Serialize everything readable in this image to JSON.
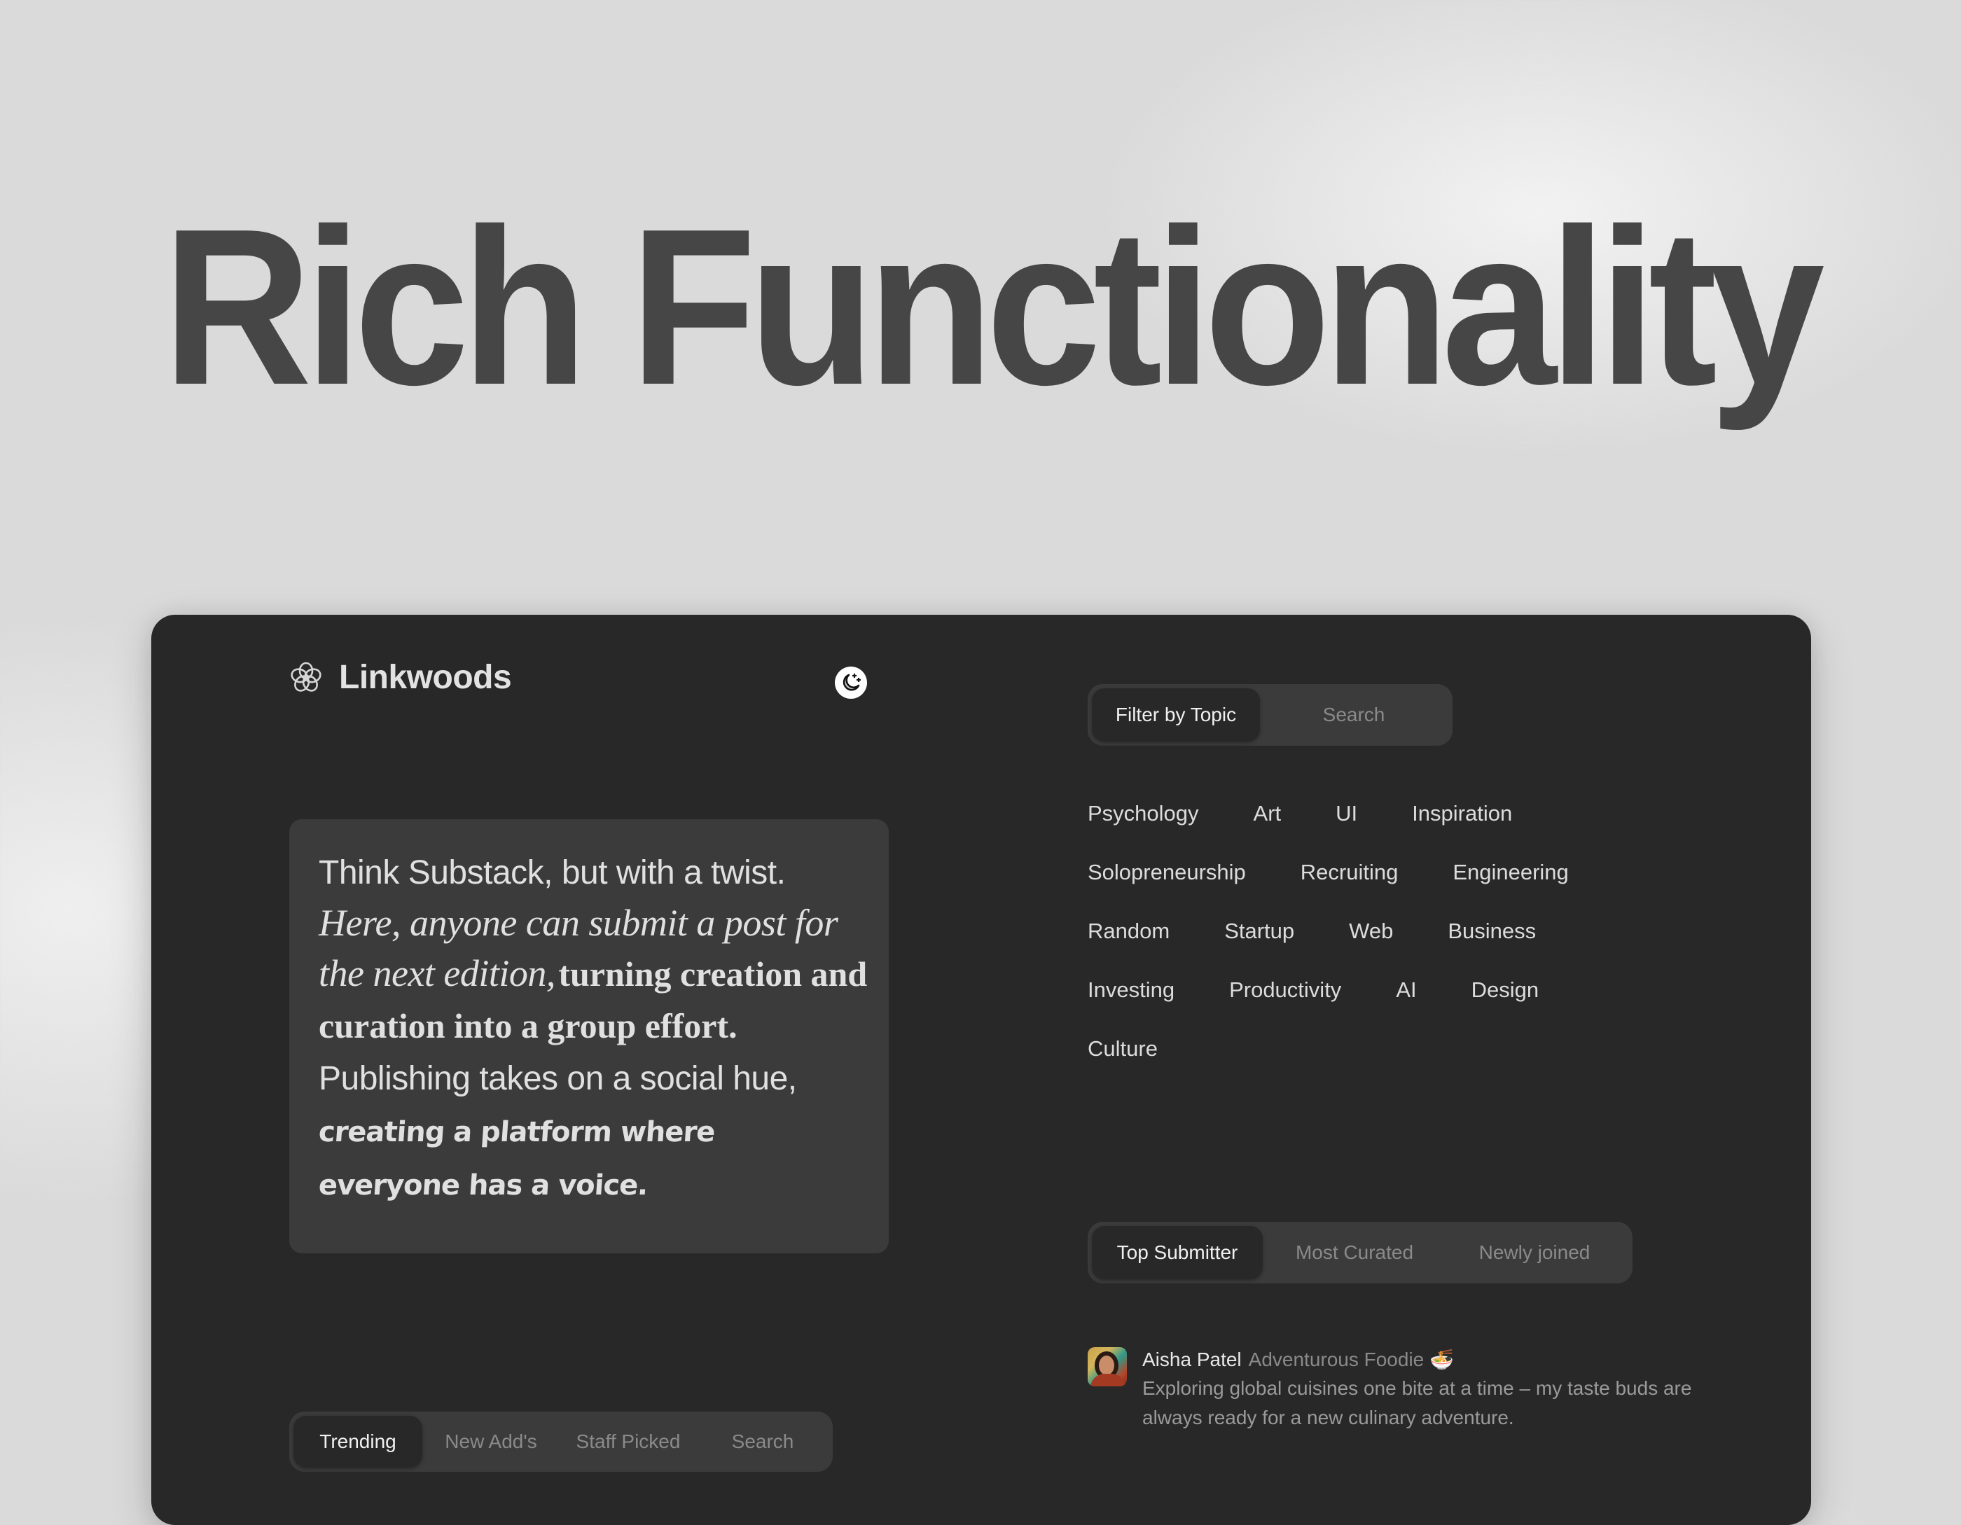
{
  "hero": {
    "title": "Rich Functionality"
  },
  "app": {
    "brand_name": "Linkwoods",
    "brand_icon": "knot-logo-icon",
    "theme_toggle_icon": "moon-stars-icon"
  },
  "quote": {
    "line1": "Think Substack, but with a twist.",
    "italic": "Here, anyone can submit a post for the next edition,",
    "bold": "turning creation and curation into a group effort.",
    "plain": "Publishing takes on a social hue,",
    "hand1": "creating a platform where",
    "hand2": "everyone has a voice."
  },
  "feed_tabs": {
    "items": [
      {
        "label": "Trending",
        "active": true
      },
      {
        "label": "New Add's",
        "active": false
      },
      {
        "label": "Staff Picked",
        "active": false
      },
      {
        "label": "Search",
        "active": false
      }
    ]
  },
  "topic_tabs": {
    "items": [
      {
        "label": "Filter by Topic",
        "active": true
      },
      {
        "label": "Search",
        "active": false
      }
    ]
  },
  "topics": {
    "rows": [
      [
        "Psychology",
        "Art",
        "UI",
        "Inspiration"
      ],
      [
        "Solopreneurship",
        "Recruiting",
        "Engineering"
      ],
      [
        "Random",
        "Startup",
        "Web",
        "Business"
      ],
      [
        "Investing",
        "Productivity",
        "AI",
        "Design"
      ],
      [
        "Culture"
      ]
    ]
  },
  "submitter_tabs": {
    "items": [
      {
        "label": "Top Submitter",
        "active": true
      },
      {
        "label": "Most Curated",
        "active": false
      },
      {
        "label": "Newly joined",
        "active": false
      }
    ]
  },
  "submitter": {
    "name": "Aisha Patel",
    "role": "Adventurous Foodie 🍜",
    "bio": "Exploring global cuisines one bite at a time – my taste buds are always ready for a new culinary adventure."
  }
}
